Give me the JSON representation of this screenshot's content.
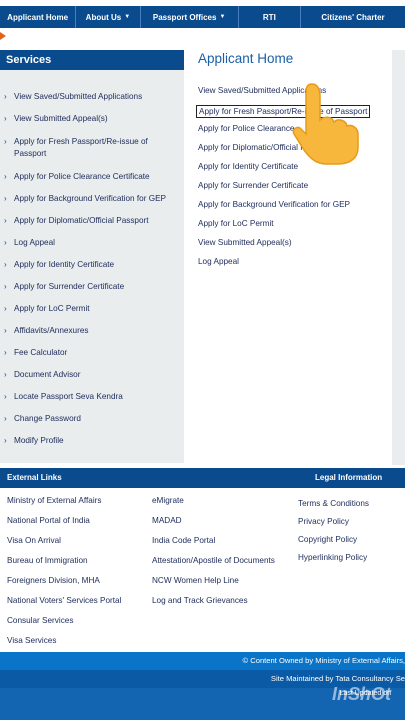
{
  "nav": {
    "items": [
      {
        "label": "Applicant Home",
        "caret": ""
      },
      {
        "label": "About Us",
        "caret": "▼"
      },
      {
        "label": "Passport Offices",
        "caret": "▼"
      },
      {
        "label": "RTI",
        "caret": ""
      },
      {
        "label": "Citizens' Charter",
        "caret": ""
      }
    ]
  },
  "sidebar": {
    "title": "Services",
    "items": [
      "View Saved/Submitted Applications",
      "View Submitted Appeal(s)",
      "Apply for Fresh Passport/Re-issue of Passport",
      "Apply for Police Clearance Certificate",
      "Apply for Background Verification for GEP",
      "Apply for Diplomatic/Official Passport",
      "Log Appeal",
      "Apply for Identity Certificate",
      "Apply for Surrender Certificate",
      "Apply for LoC Permit",
      "Affidavits/Annexures",
      "Fee Calculator",
      "Document Advisor",
      "Locate Passport Seva Kendra",
      "Change Password",
      "Modify Profile"
    ]
  },
  "main": {
    "title": "Applicant Home",
    "links": [
      "View Saved/Submitted Applications",
      "Apply for Fresh Passport/Re-issue of Passport",
      "Apply for Police Clearance",
      "Apply for Diplomatic/Official P",
      "Apply for Identity Certificate",
      "Apply for Surrender Certificate",
      "Apply for Background Verification for GEP",
      "Apply for LoC Permit",
      "View Submitted Appeal(s)",
      "Log Appeal"
    ]
  },
  "footer": {
    "external_title": "External Links",
    "legal_title": "Legal Information",
    "col1": [
      "Ministry of External Affairs",
      "National Portal of India",
      "Visa On Arrival",
      "Bureau of Immigration",
      "Foreigners Division, MHA",
      "National Voters' Services Portal",
      "Consular Services",
      "Visa Services"
    ],
    "col2": [
      "eMigrate",
      "MADAD",
      "India Code Portal",
      "Attestation/Apostile of Documents",
      "NCW Women Help Line",
      "Log and Track Grievances"
    ],
    "col3": [
      "Terms & Conditions",
      "Privacy Policy",
      "Copyright Policy",
      "Hyperlinking Policy"
    ]
  },
  "bottom": {
    "owned": "© Content Owned by Ministry of External Affairs,",
    "maintained": "Site Maintained by Tata Consultancy Se",
    "updated": "Last Updated on",
    "watermark": "InShOt"
  },
  "colors": {
    "nav_bg": "#0a4b8e",
    "title_blue": "#1a5fa8",
    "sidebar_bg": "#e9edee",
    "accent_orange": "#e0651b"
  }
}
